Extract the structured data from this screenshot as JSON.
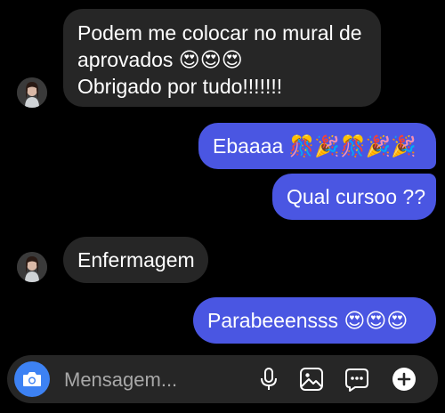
{
  "colors": {
    "background": "#000000",
    "incoming_bubble": "#262626",
    "outgoing_bubble": "#4a56e2",
    "composer_background": "#262626",
    "camera_button": "#3d82f4",
    "placeholder_text": "#a8a8a8"
  },
  "messages": [
    {
      "direction": "incoming",
      "sender_avatar": "avatar",
      "lines": [
        "Podem me colocar no mural de",
        "aprovados 😍😍😍",
        "Obrigado por tudo!!!!!!!"
      ]
    },
    {
      "direction": "outgoing",
      "lines": [
        "Ebaaaa 🎊🎉🎊🎉🎉"
      ]
    },
    {
      "direction": "outgoing",
      "lines": [
        "Qual cursoo ??"
      ]
    },
    {
      "direction": "incoming",
      "sender_avatar": "avatar",
      "lines": [
        "Enfermagem"
      ]
    },
    {
      "direction": "outgoing",
      "lines": [
        "Parabeeensss 😍😍😍"
      ]
    }
  ],
  "composer": {
    "placeholder": "Mensagem...",
    "icons": [
      "camera-icon",
      "microphone-icon",
      "gallery-icon",
      "sticker-icon",
      "plus-icon"
    ]
  }
}
